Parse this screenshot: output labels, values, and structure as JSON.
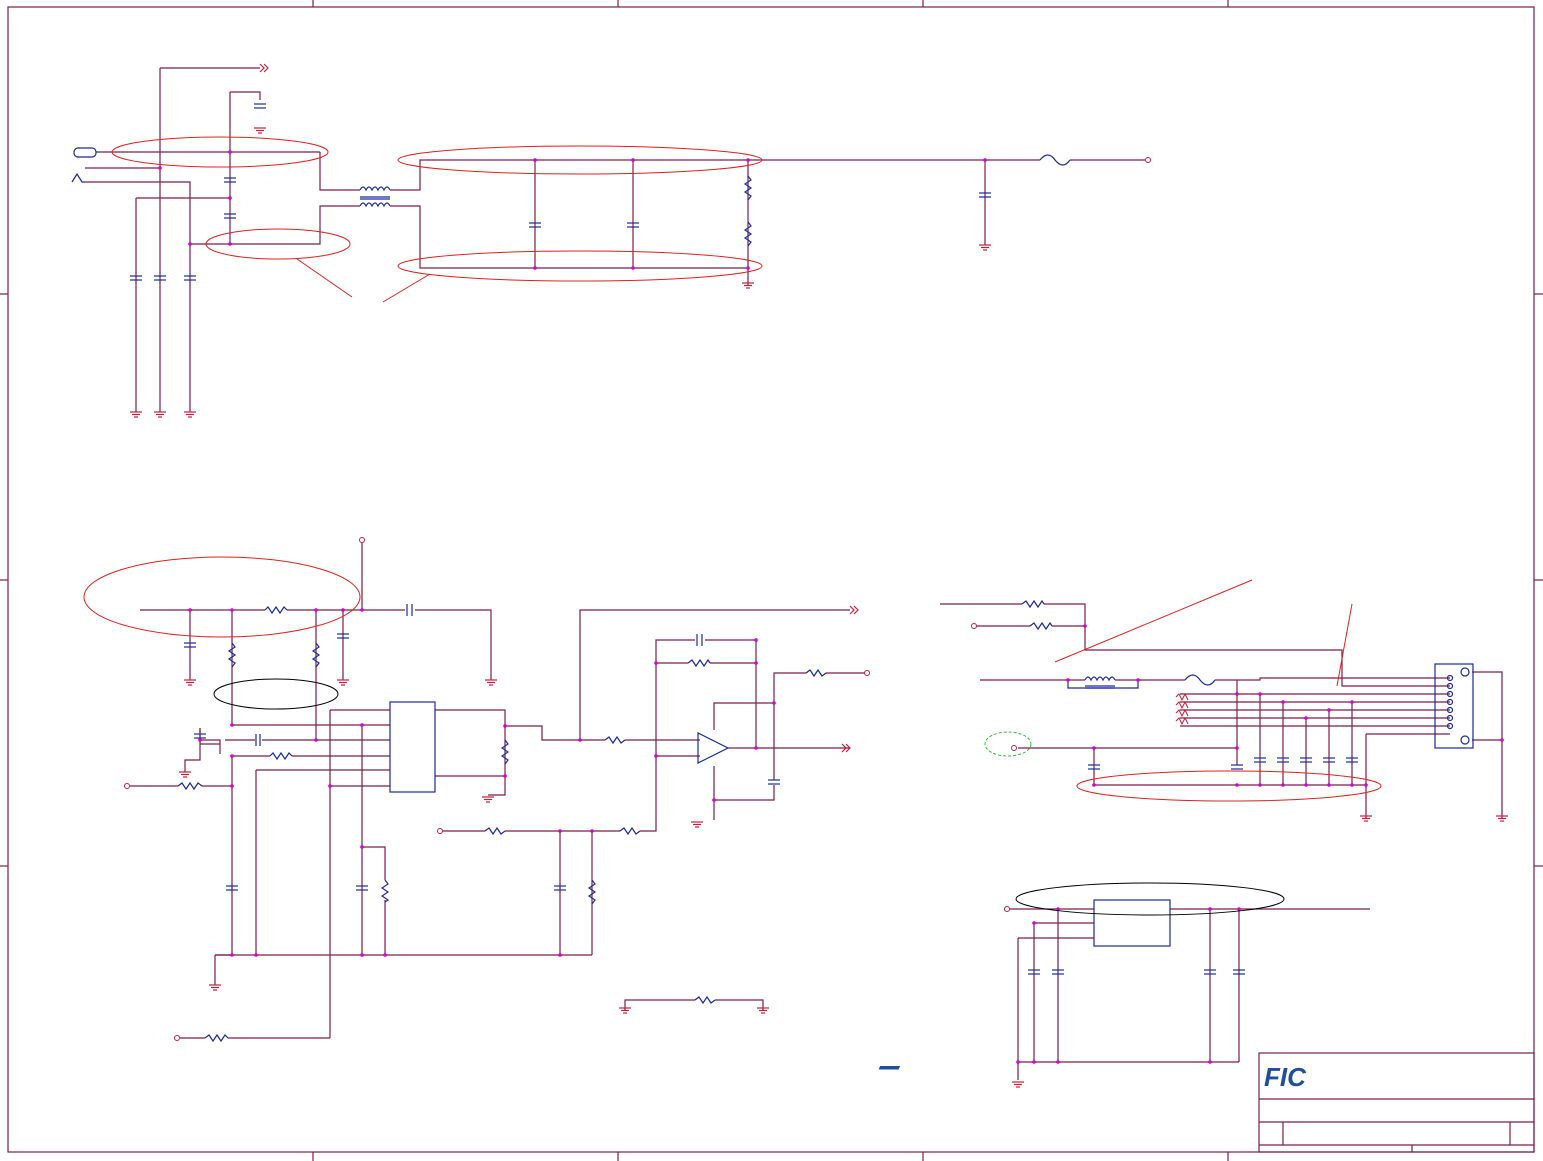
{
  "sheet": {
    "logo_text": "FIC",
    "logo_color": "#1f4e9c",
    "title_block": {
      "size_label": "",
      "title": "",
      "document_number": "",
      "revision": "",
      "date": "",
      "sheet_of": ""
    }
  },
  "colors": {
    "wire": "#7a1f4a",
    "border": "#7a1f4a",
    "component": "#1a2a9c",
    "junction": "#d400d4",
    "ground": "#c41e3a",
    "annotation_red": "#e02020",
    "annotation_black": "#000000",
    "annotation_green": "#2fbf2f",
    "pin": "#c41e3a"
  },
  "annotations": {
    "red_ellipses": 6,
    "black_ellipses": 2,
    "green_dashed_ellipses": 1,
    "callout_lines": 4
  }
}
